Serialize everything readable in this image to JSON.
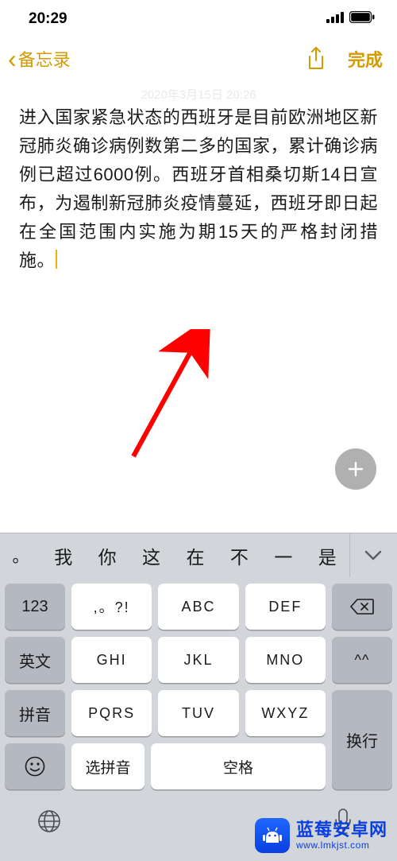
{
  "status_bar": {
    "time": "20:29"
  },
  "nav": {
    "back_label": "备忘录",
    "done_label": "完成"
  },
  "note": {
    "date": "2020年3月15日 20:26",
    "body": "进入国家紧急状态的西班牙是目前欧洲地区新冠肺炎确诊病例数第二多的国家，累计确诊病例已超过6000例。西班牙首相桑切斯14日宣布，为遏制新冠肺炎疫情蔓延，西班牙即日起在全国范围内实施为期15天的严格封闭措施。"
  },
  "keyboard": {
    "suggestions": {
      "punct": "。",
      "items": [
        "我",
        "你",
        "这",
        "在",
        "不",
        "一",
        "是"
      ]
    },
    "rows": {
      "r1": {
        "side": "123",
        "keys": [
          ",。?!",
          "ABC",
          "DEF"
        ],
        "back_icon": "backspace-icon"
      },
      "r2": {
        "side": "英文",
        "keys": [
          "GHI",
          "JKL",
          "MNO"
        ],
        "caret": "^^"
      },
      "r3": {
        "side": "拼音",
        "keys": [
          "PQRS",
          "TUV",
          "WXYZ"
        ]
      },
      "r4": {
        "emoji": "☺",
        "selpy": "选拼音",
        "space": "空格",
        "ret": "换行"
      }
    }
  },
  "watermark": {
    "line1": "蓝莓安卓网",
    "line2": "www.lmkjst.com"
  }
}
